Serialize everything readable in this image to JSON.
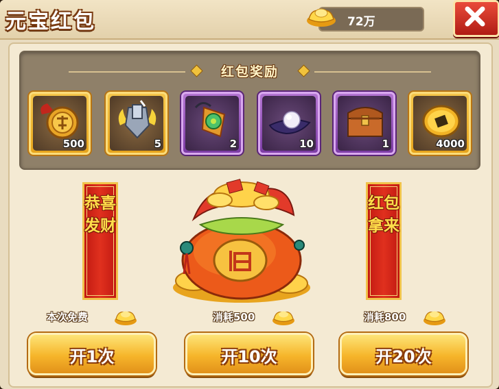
{
  "header": {
    "title": "元宝红包",
    "gold_amount": "72万"
  },
  "rewards": {
    "title": "红包奖励",
    "items": [
      {
        "icon": "medal-icon",
        "qty": "500",
        "rarity": "gold"
      },
      {
        "icon": "armor-icon",
        "qty": "5",
        "rarity": "gold"
      },
      {
        "icon": "jade-pendant-icon",
        "qty": "2",
        "rarity": "purple"
      },
      {
        "icon": "pearl-icon",
        "qty": "10",
        "rarity": "purple"
      },
      {
        "icon": "treasure-chest-icon",
        "qty": "1",
        "rarity": "purple"
      },
      {
        "icon": "coin-icon",
        "qty": "4000",
        "rarity": "gold"
      }
    ]
  },
  "banners": {
    "left": "恭喜发财",
    "right": "红包拿来"
  },
  "options": [
    {
      "cost": "本次免费",
      "button": "开1次"
    },
    {
      "cost": "消耗500",
      "button": "开10次"
    },
    {
      "cost": "消耗800",
      "button": "开20次"
    }
  ],
  "colors": {
    "gold": "#f0b429",
    "purple": "#9a52c0",
    "banner_red": "#d4231a",
    "panel": "#8f8069"
  }
}
